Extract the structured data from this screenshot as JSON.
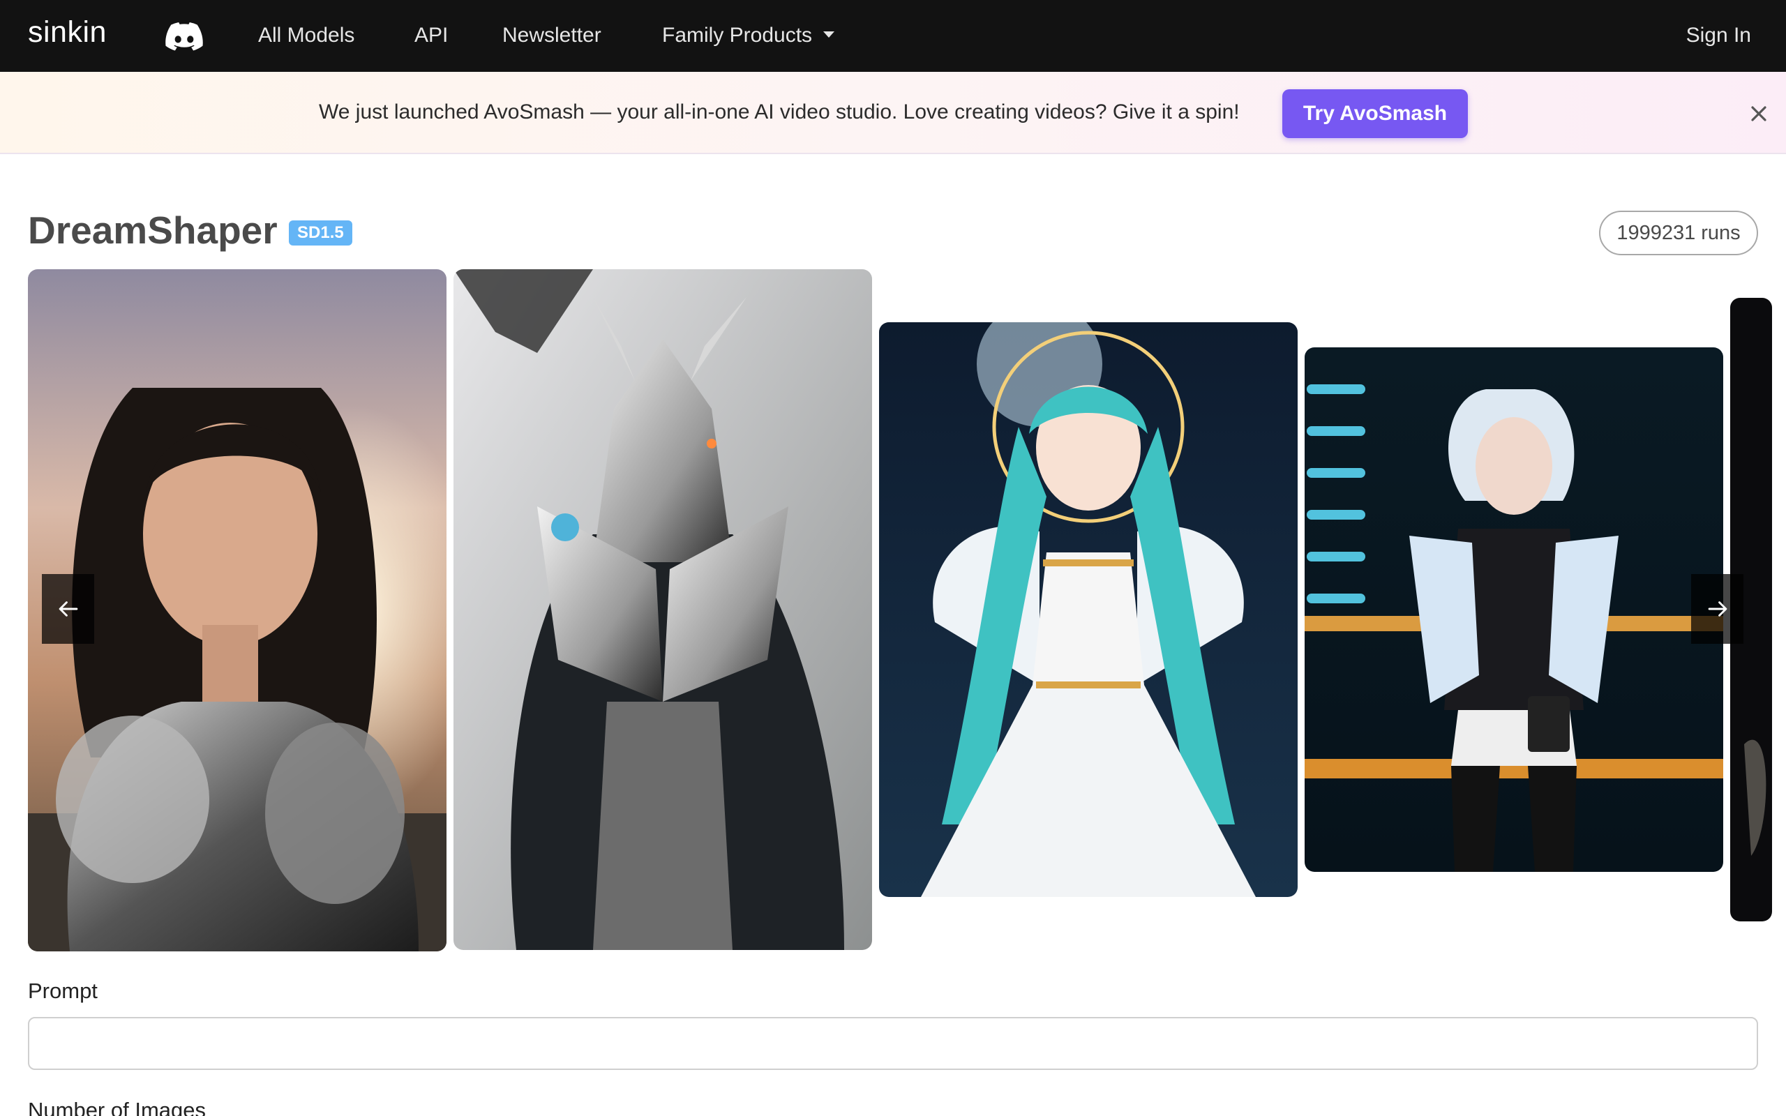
{
  "nav": {
    "brand": "sinkin",
    "links": [
      "All Models",
      "API",
      "Newsletter",
      "Family Products"
    ],
    "signin": "Sign In"
  },
  "banner": {
    "text": "We just launched AvoSmash — your all-in-one AI video studio. Love creating videos? Give it a spin!",
    "button": "Try AvoSmash"
  },
  "model": {
    "title": "DreamShaper",
    "badge": "SD1.5",
    "runs": "1999231 runs"
  },
  "form": {
    "prompt_label": "Prompt",
    "prompt_value": "",
    "prompt_placeholder": "",
    "num_images_label": "Number of Images"
  },
  "colors": {
    "navbar": "#121212",
    "accent": "#7758f2",
    "badge": "#64b5f6"
  }
}
